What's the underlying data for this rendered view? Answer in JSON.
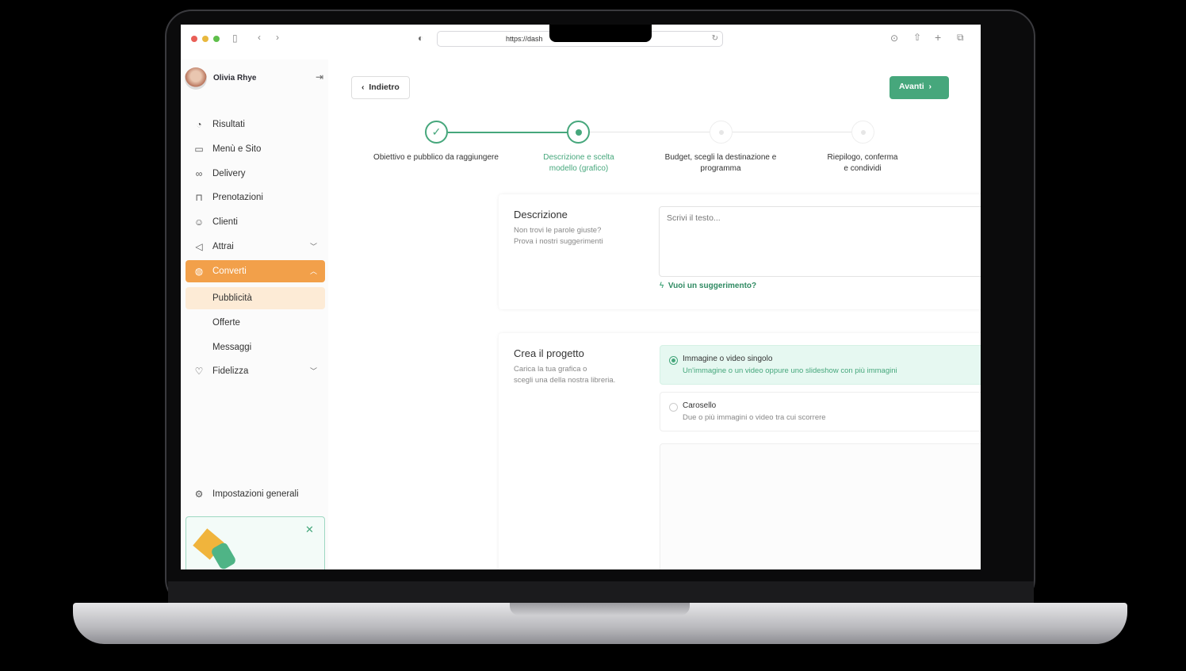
{
  "browser": {
    "url": "https://dash"
  },
  "user": {
    "name": "Olivia Rhye"
  },
  "sidebar": {
    "items": [
      {
        "label": "Risultati",
        "icon": "pie-chart-icon"
      },
      {
        "label": "Menù e Sito",
        "icon": "book-icon"
      },
      {
        "label": "Delivery",
        "icon": "bicycle-icon"
      },
      {
        "label": "Prenotazioni",
        "icon": "table-icon"
      },
      {
        "label": "Clienti",
        "icon": "users-icon"
      },
      {
        "label": "Attrai",
        "icon": "megaphone-icon"
      },
      {
        "label": "Converti",
        "icon": "lightbulb-icon"
      },
      {
        "label": "Pubblicità"
      },
      {
        "label": "Offerte"
      },
      {
        "label": "Messaggi"
      },
      {
        "label": "Fidelizza",
        "icon": "loyalty-icon"
      }
    ],
    "settings": "Impostazioni generali"
  },
  "colors": {
    "accent": "#f2a04a",
    "primary": "#46a77c",
    "selected_bg": "#e6f8f1"
  },
  "header": {
    "back": "Indietro",
    "next": "Avanti"
  },
  "steps": [
    {
      "label": "Obiettivo e pubblico da raggiungere",
      "state": "done"
    },
    {
      "label": "Descrizione e scelta modello (grafico)",
      "state": "current"
    },
    {
      "label": "Budget, scegli la destinazione e programma",
      "state": "pending"
    },
    {
      "label": "Riepilogo, conferma e condividi",
      "state": "pending"
    }
  ],
  "description": {
    "title": "Descrizione",
    "subtitle1": "Non trovi le parole giuste?",
    "subtitle2": "Prova i nostri suggerimenti",
    "placeholder": "Scrivi il testo...",
    "suggest": "Vuoi un suggerimento?"
  },
  "project": {
    "title": "Crea il progetto",
    "subtitle1": "Carica la tua grafica o",
    "subtitle2": "scegli una della nostra libreria.",
    "options": [
      {
        "title": "Immagine o video singolo",
        "desc": "Un'immagine o un video oppure uno slideshow con più immagini",
        "selected": true
      },
      {
        "title": "Carosello",
        "desc": "Due o più immagini o video tra cui scorrere",
        "selected": false
      }
    ]
  }
}
